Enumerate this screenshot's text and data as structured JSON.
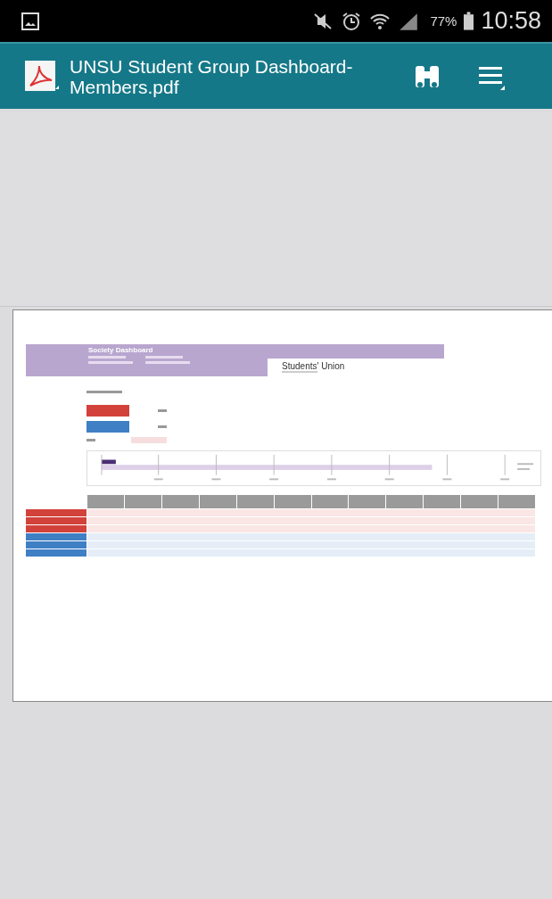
{
  "status_bar": {
    "battery": "77%",
    "time": "10:58"
  },
  "app_bar": {
    "title": "UNSU Student Group Dashboard-Members.pdf"
  },
  "document": {
    "title": "Society Dashboard",
    "organisation": "Students' Union",
    "summary_rows": [
      {
        "color": "#d2423b"
      },
      {
        "color": "#3f7fc4"
      }
    ],
    "table_rows": [
      {
        "color": "#d2423b"
      },
      {
        "color": "#d2423b"
      },
      {
        "color": "#d2423b"
      },
      {
        "color": "#3f7fc4"
      },
      {
        "color": "#3f7fc4"
      },
      {
        "color": "#3f7fc4"
      }
    ]
  }
}
